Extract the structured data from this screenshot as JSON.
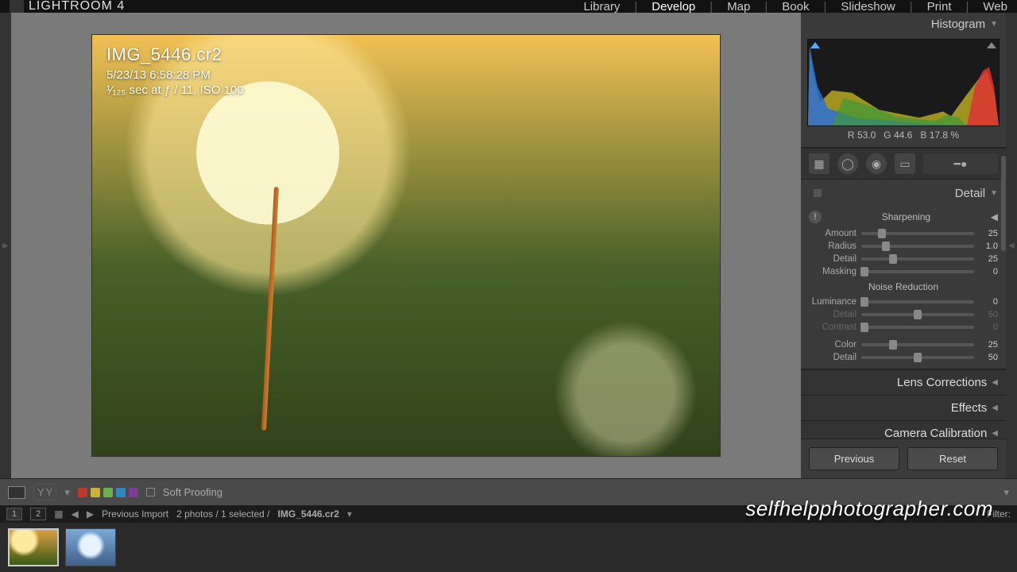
{
  "app": {
    "name": "LIGHTROOM 4",
    "modules": [
      "Library",
      "Develop",
      "Map",
      "Book",
      "Slideshow",
      "Print",
      "Web"
    ],
    "active_module": "Develop"
  },
  "image": {
    "filename": "IMG_5446.cr2",
    "datetime": "5/23/13 6:58:28 PM",
    "exposure": "¹⁄₁₂₅ sec at ƒ / 11, ISO 100"
  },
  "histogram": {
    "title": "Histogram",
    "rgb": {
      "r_label": "R",
      "r": "53.0",
      "g_label": "G",
      "g": "44.6",
      "b_label": "B",
      "b": "17.8",
      "unit": "%"
    }
  },
  "tools": [
    "crop",
    "spot",
    "redeye",
    "gradient",
    "brush"
  ],
  "detail_panel": {
    "title": "Detail",
    "sharpening": {
      "title": "Sharpening",
      "amount": {
        "label": "Amount",
        "value": "25",
        "pos": 18
      },
      "radius": {
        "label": "Radius",
        "value": "1.0",
        "pos": 22
      },
      "detail": {
        "label": "Detail",
        "value": "25",
        "pos": 28
      },
      "masking": {
        "label": "Masking",
        "value": "0",
        "pos": 3
      }
    },
    "noise": {
      "title": "Noise Reduction",
      "luminance": {
        "label": "Luminance",
        "value": "0",
        "pos": 3
      },
      "lum_detail": {
        "label": "Detail",
        "value": "50",
        "pos": 50,
        "dim": true
      },
      "lum_contrast": {
        "label": "Contrast",
        "value": "0",
        "pos": 3,
        "dim": true
      },
      "color": {
        "label": "Color",
        "value": "25",
        "pos": 28
      },
      "col_detail": {
        "label": "Detail",
        "value": "50",
        "pos": 50
      }
    }
  },
  "collapsed_panels": [
    "Lens Corrections",
    "Effects",
    "Camera Calibration"
  ],
  "footer_buttons": {
    "previous": "Previous",
    "reset": "Reset"
  },
  "toolbar": {
    "color_chips": [
      "#c0392b",
      "#c9b037",
      "#6ab04c",
      "#2e86c1",
      "#7d3c98"
    ],
    "soft_proofing": "Soft Proofing"
  },
  "filmstrip_header": {
    "source": "Previous Import",
    "counts": "2 photos / 1 selected /",
    "current": "IMG_5446.cr2",
    "filter_label": "Filter:"
  },
  "watermark": "selfhelpphotographer.com"
}
